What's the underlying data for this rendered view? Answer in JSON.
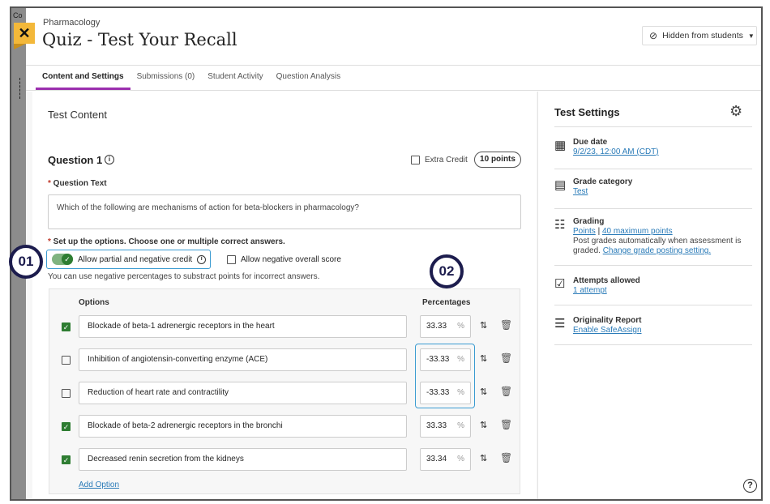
{
  "header": {
    "breadcrumb": "Pharmacology",
    "title": "Quiz - Test Your Recall",
    "visibility": "Hidden from students",
    "close": "✕"
  },
  "tabs": [
    {
      "label": "Content and Settings",
      "active": true
    },
    {
      "label": "Submissions (0)"
    },
    {
      "label": "Student Activity"
    },
    {
      "label": "Question Analysis"
    }
  ],
  "content": {
    "heading": "Test Content",
    "question_title": "Question 1",
    "extra_credit": "Extra Credit",
    "points": "10 points",
    "question_text_label": "Question Text",
    "question_text": "Which of the following are mechanisms of action for beta-blockers in pharmacology?",
    "setup_label": "Set up the options. Choose one or multiple correct answers.",
    "partial_credit": "Allow partial and negative credit",
    "negative_score": "Allow negative overall score",
    "hint": "You can use negative percentages to substract points for incorrect answers.",
    "options_header": "Options",
    "percent_header": "Percentages",
    "percent_sign": "%",
    "options": [
      {
        "text": "Blockade of beta-1 adrenergic receptors in the heart",
        "correct": true,
        "percent": "33.33"
      },
      {
        "text": "Inhibition of angiotensin-converting enzyme (ACE)",
        "correct": false,
        "percent": "-33.33"
      },
      {
        "text": "Reduction of heart rate and contractility",
        "correct": false,
        "percent": "-33.33"
      },
      {
        "text": "Blockade of beta-2 adrenergic receptors in the bronchi",
        "correct": true,
        "percent": "33.33"
      },
      {
        "text": "Decreased renin secretion from the kidneys",
        "correct": true,
        "percent": "33.34"
      }
    ],
    "add_option": "Add Option"
  },
  "callouts": {
    "one": "01",
    "two": "02"
  },
  "settings": {
    "title": "Test Settings",
    "due_label": "Due date",
    "due_value": "9/2/23, 12:00 AM (CDT)",
    "category_label": "Grade category",
    "category_value": "Test",
    "grading_label": "Grading",
    "grading_points": "Points",
    "grading_sep": "|",
    "grading_max": "40 maximum points",
    "grading_text": "Post grades automatically when assessment is graded.",
    "grading_link": "Change grade posting setting.",
    "attempts_label": "Attempts allowed",
    "attempts_value": "1 attempt",
    "originality_label": "Originality Report",
    "originality_value": "Enable SafeAssign"
  },
  "colors": {
    "accent": "#9b2fae",
    "check": "#2e7d32",
    "link": "#2a7bb8",
    "callout": "#1c1c4d",
    "close": "#f3b83a"
  }
}
